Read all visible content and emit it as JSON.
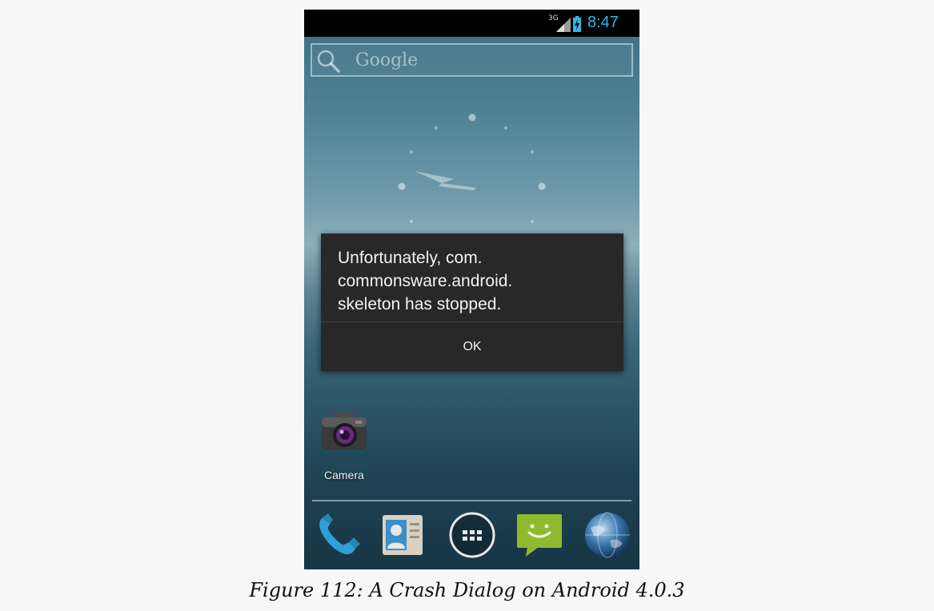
{
  "status_bar": {
    "network": "3G",
    "time": "8:47",
    "icons": [
      "signal-icon",
      "battery-charging-icon"
    ],
    "time_color": "#33b5e5"
  },
  "search_widget": {
    "label": "Google",
    "icon": "search-icon"
  },
  "crash_dialog": {
    "message": "Unfortunately, com.\ncommonsware.android.\nskeleton has stopped.",
    "ok_label": "OK"
  },
  "home_apps": [
    {
      "label": "Camera",
      "icon": "camera-icon"
    }
  ],
  "dock": {
    "items": [
      "phone-icon",
      "contacts-icon",
      "app-drawer-icon",
      "messaging-icon",
      "browser-globe-icon"
    ]
  },
  "caption": "Figure 112: A Crash Dialog on Android 4.0.3"
}
